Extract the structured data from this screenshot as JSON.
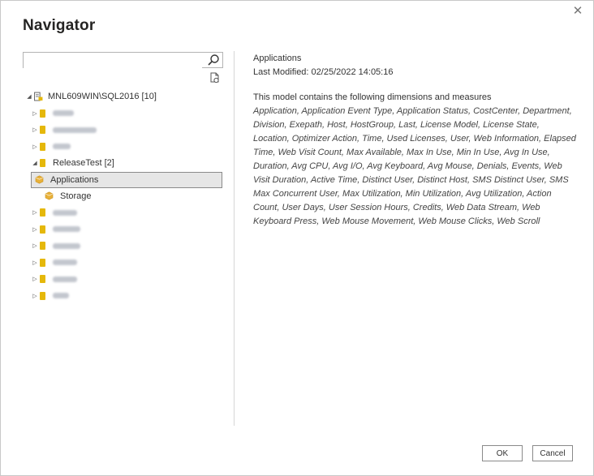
{
  "dialog": {
    "title": "Navigator",
    "close_glyph": "✕"
  },
  "search": {
    "value": "",
    "placeholder": ""
  },
  "tree": {
    "server": {
      "label": "MNL609WIN\\SQL2016 [10]",
      "icon": "server-database-icon",
      "expanded": true
    },
    "databases_before": [
      {
        "label": "",
        "icon": "database-icon",
        "blurred": true,
        "blur_width": 26
      },
      {
        "label": "",
        "icon": "database-icon",
        "blurred": true,
        "blur_width": 54
      },
      {
        "label": "",
        "icon": "database-icon",
        "blurred": true,
        "blur_width": 22
      }
    ],
    "expanded_db": {
      "label": "ReleaseTest [2]",
      "icon": "database-icon",
      "children": [
        {
          "label": "Applications",
          "icon": "cube-icon",
          "selected": true
        },
        {
          "label": "Storage",
          "icon": "cube-icon",
          "selected": false
        }
      ]
    },
    "databases_after": [
      {
        "label": "",
        "icon": "database-icon",
        "blurred": true,
        "blur_width": 30
      },
      {
        "label": "",
        "icon": "database-icon",
        "blurred": true,
        "blur_width": 34
      },
      {
        "label": "",
        "icon": "database-icon",
        "blurred": true,
        "blur_width": 34
      },
      {
        "label": "",
        "icon": "database-icon",
        "blurred": true,
        "blur_width": 30
      },
      {
        "label": "",
        "icon": "database-icon",
        "blurred": true,
        "blur_width": 30
      },
      {
        "label": "",
        "icon": "database-icon",
        "blurred": true,
        "blur_width": 20
      }
    ]
  },
  "details": {
    "name": "Applications",
    "last_modified": "Last Modified: 02/25/2022 14:05:16",
    "intro": "This model contains the following dimensions and measures",
    "list": "Application, Application Event Type, Application Status, CostCenter, Department, Division, Exepath, Host, HostGroup, Last, License Model, License State, Location, Optimizer Action, Time, Used Licenses, User, Web Information, Elapsed Time, Web Visit Count, Max Available, Max In Use, Min In Use, Avg In Use, Duration, Avg CPU, Avg I/O, Avg Keyboard, Avg Mouse, Denials, Events, Web Visit Duration, Active Time, Distinct User, Distinct Host, SMS Distinct User, SMS Max Concurrent User, Max Utilization, Min Utilization, Avg Utilization, Action Count, User Days, User Session Hours, Credits, Web Data Stream, Web Keyboard Press, Web Mouse Movement, Web Mouse Clicks, Web Scroll"
  },
  "buttons": {
    "ok": "OK",
    "cancel": "Cancel"
  },
  "colors": {
    "database": "#e5b80b",
    "selected_bg": "#e6e6e6",
    "cube": "#e8b13a"
  }
}
